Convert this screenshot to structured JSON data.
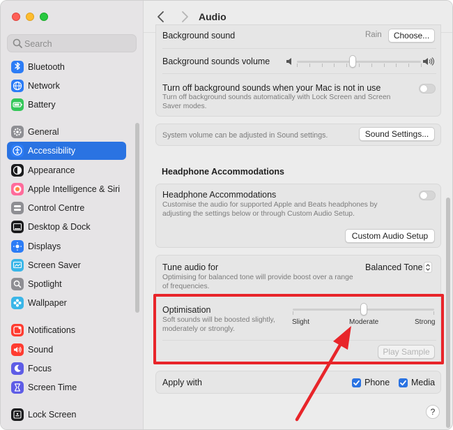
{
  "window": {
    "title": "Audio"
  },
  "search": {
    "placeholder": "Search"
  },
  "sidebar": {
    "items": [
      {
        "label": "Bluetooth",
        "icon": "bluetooth-icon",
        "color": "#2c7cf6"
      },
      {
        "label": "Network",
        "icon": "globe-icon",
        "color": "#2c7cf6"
      },
      {
        "label": "Battery",
        "icon": "battery-icon",
        "color": "#34c759"
      },
      {
        "label": "General",
        "icon": "gear-icon",
        "color": "#8e8e93"
      },
      {
        "label": "Accessibility",
        "icon": "accessibility-icon",
        "color": "#2c7cf6",
        "selected": true
      },
      {
        "label": "Appearance",
        "icon": "appearance-icon",
        "color": "#1c1c1e"
      },
      {
        "label": "Apple Intelligence & Siri",
        "icon": "siri-icon",
        "color": "#ff6b9a"
      },
      {
        "label": "Control Centre",
        "icon": "control-centre-icon",
        "color": "#8e8e93"
      },
      {
        "label": "Desktop & Dock",
        "icon": "desktop-dock-icon",
        "color": "#1c1c1e"
      },
      {
        "label": "Displays",
        "icon": "displays-icon",
        "color": "#2c7cf6"
      },
      {
        "label": "Screen Saver",
        "icon": "screen-saver-icon",
        "color": "#3ab6e8"
      },
      {
        "label": "Spotlight",
        "icon": "spotlight-icon",
        "color": "#8e8e93"
      },
      {
        "label": "Wallpaper",
        "icon": "wallpaper-icon",
        "color": "#3ab6e8"
      },
      {
        "label": "Notifications",
        "icon": "notifications-icon",
        "color": "#ff3b30"
      },
      {
        "label": "Sound",
        "icon": "sound-icon",
        "color": "#ff3b30"
      },
      {
        "label": "Focus",
        "icon": "focus-icon",
        "color": "#5e5ce6"
      },
      {
        "label": "Screen Time",
        "icon": "screen-time-icon",
        "color": "#5e5ce6"
      },
      {
        "label": "Lock Screen",
        "icon": "lock-screen-icon",
        "color": "#1c1c1e"
      }
    ]
  },
  "background_sound": {
    "label": "Background sound",
    "value": "Rain",
    "button": "Choose..."
  },
  "background_volume": {
    "label": "Background sounds volume",
    "level": 0.45
  },
  "turn_off": {
    "label": "Turn off background sounds when your Mac is not in use",
    "desc": "Turn off background sounds automatically with Lock Screen and Screen Saver modes.",
    "enabled": false
  },
  "system_volume": {
    "note": "System volume can be adjusted in Sound settings.",
    "button": "Sound Settings..."
  },
  "headphone_section": {
    "heading": "Headphone Accommodations"
  },
  "headphone": {
    "label": "Headphone Accommodations",
    "desc": "Customise the audio for supported Apple and Beats headphones by adjusting the settings below or through Custom Audio Setup.",
    "enabled": false,
    "button": "Custom Audio Setup"
  },
  "tune": {
    "label": "Tune audio for",
    "value": "Balanced Tone",
    "desc": "Optimising for balanced tone will provide boost over a range of frequencies."
  },
  "optimisation": {
    "label": "Optimisation",
    "desc": "Soft sounds will be boosted slightly, moderately or strongly.",
    "options": [
      "Slight",
      "Moderate",
      "Strong"
    ],
    "level": 0.5,
    "play_button": "Play Sample"
  },
  "apply": {
    "label": "Apply with",
    "phone": "Phone",
    "media": "Media",
    "phone_checked": true,
    "media_checked": true
  },
  "help": {
    "label": "?"
  },
  "colors": {
    "accent": "#2a73e2",
    "highlight": "#e8252a"
  }
}
